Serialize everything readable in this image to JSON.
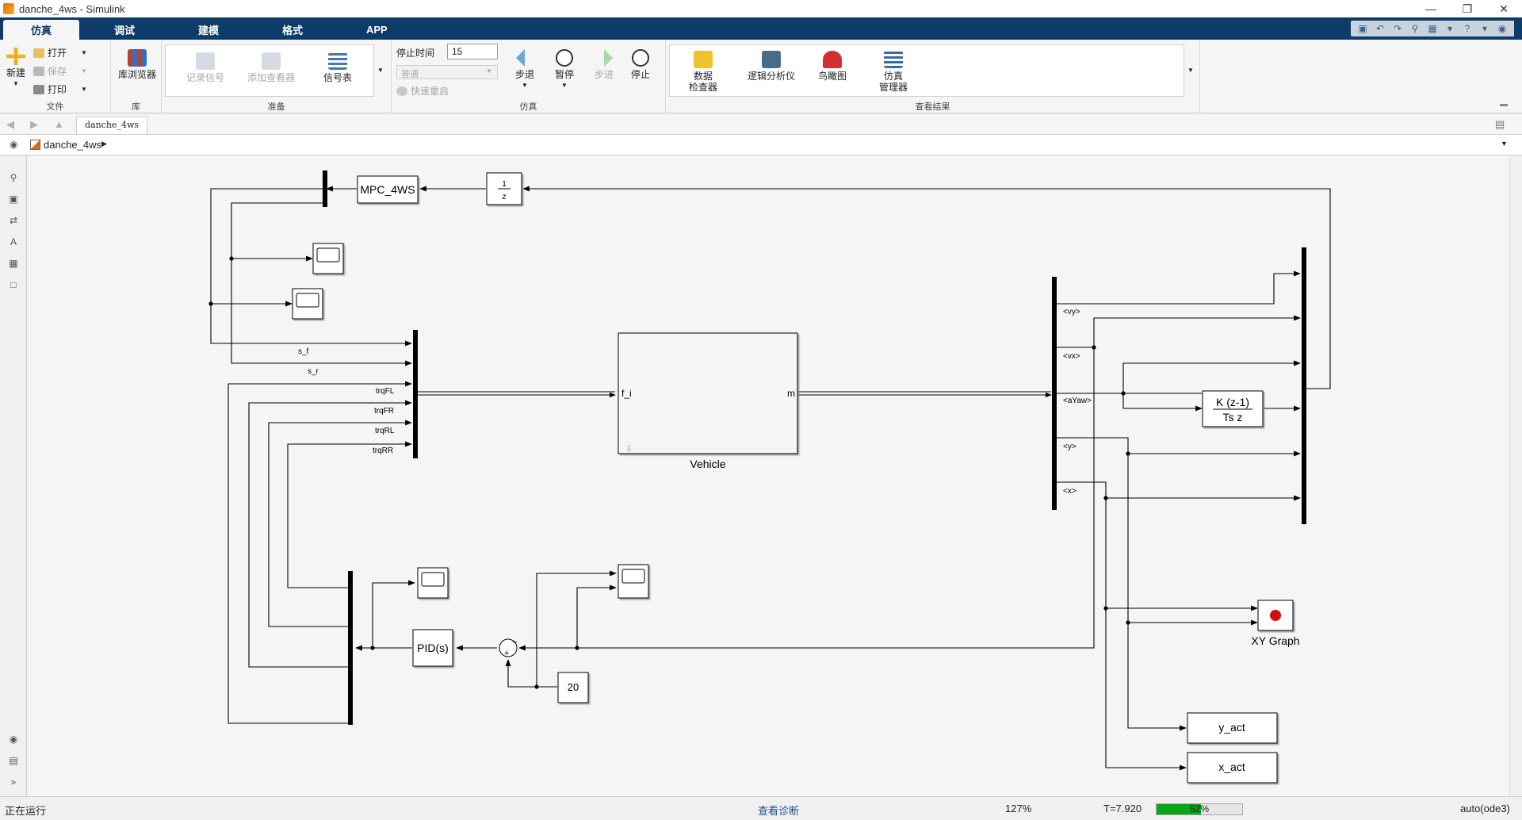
{
  "window": {
    "title": "danche_4ws - Simulink"
  },
  "tabs": [
    "仿真",
    "调试",
    "建模",
    "格式",
    "APP"
  ],
  "ribbon": {
    "file": {
      "label": "文件",
      "new": "新建",
      "open": "打开",
      "save": "保存",
      "print": "打印"
    },
    "library": {
      "label": "库",
      "browser": "库浏览器"
    },
    "prepare": {
      "label": "准备",
      "log_signals": "记录信号",
      "add_viewer": "添加查看器",
      "signal_table": "信号表"
    },
    "simulate": {
      "label": "仿真",
      "stop_time_label": "停止时间",
      "stop_time_value": "15",
      "mode_value": "普通",
      "fast_restart": "快速重启",
      "step_back": "步退",
      "pause": "暂停",
      "step_forward": "步进",
      "stop": "停止"
    },
    "review": {
      "label": "查看结果",
      "data_inspector_1": "数据",
      "data_inspector_2": "检查器",
      "logic_analyzer": "逻辑分析仪",
      "birds_eye": "鸟瞰图",
      "sim_manager_1": "仿真",
      "sim_manager_2": "管理器"
    }
  },
  "nav": {
    "doc_tab": "danche_4ws",
    "breadcrumb": "danche_4ws"
  },
  "diagram": {
    "blocks": {
      "mpc": "MPC_4WS",
      "delay_num": "1",
      "delay_den": "z",
      "vehicle_in": "f_i",
      "vehicle_out": "m",
      "vehicle": "Vehicle",
      "pid": "PID(s)",
      "const": "20",
      "deriv_num": "K (z-1)",
      "deriv_den": "Ts z",
      "xygraph": "XY Graph",
      "y_act": "y_act",
      "x_act": "x_act",
      "sum_minus": "−",
      "sum_plus": "+"
    },
    "signals": {
      "s_f": "s_f",
      "s_r": "s_r",
      "trqFL": "trqFL",
      "trqFR": "trqFR",
      "trqRL": "trqRL",
      "trqRR": "trqRR",
      "vy": "<vy>",
      "vx": "<vx>",
      "aYaw": "<aYaw>",
      "y": "<y>",
      "x": "<x>"
    }
  },
  "status": {
    "state": "正在运行",
    "diagnostics": "查看诊断",
    "zoom": "127%",
    "time": "T=7.920",
    "progress_label": "52%",
    "progress": 0.52,
    "solver": "auto(ode3)"
  }
}
